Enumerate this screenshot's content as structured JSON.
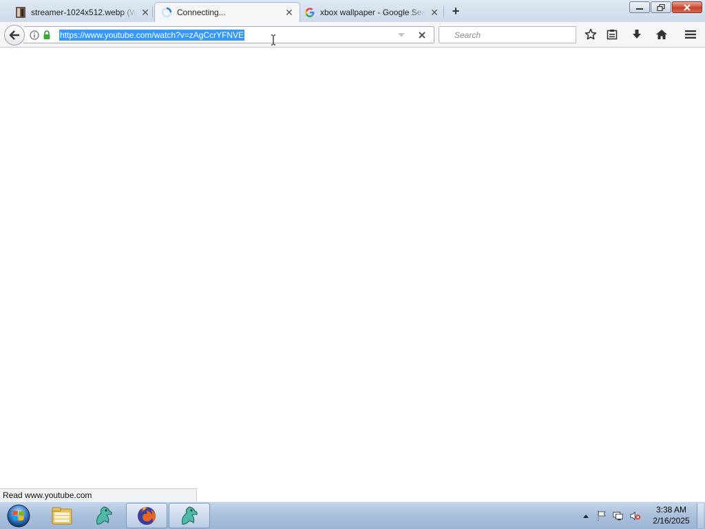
{
  "browser": {
    "tabs": [
      {
        "title": "streamer-1024x512.webp (W",
        "favicon": "image-thumbnail-icon",
        "active": false
      },
      {
        "title": "Connecting...",
        "favicon": "loading-spinner-icon",
        "active": true
      },
      {
        "title": "xbox wallpaper - Google Sea",
        "favicon": "google-g-icon",
        "active": false
      }
    ],
    "new_tab_label": "+",
    "url": "https://www.youtube.com/watch?v=zAgCcrYFNVE",
    "search_placeholder": "Search",
    "status_text": "Read www.youtube.com"
  },
  "toolbar_icons": [
    "back-arrow-icon",
    "info-icon",
    "lock-icon",
    "dropdown-arrow-icon",
    "stop-icon",
    "bookmark-star-icon",
    "reading-list-icon",
    "download-icon",
    "home-icon",
    "hamburger-menu-icon"
  ],
  "taskbar": {
    "pinned": [
      "windows-explorer-icon",
      "app-dragon-icon",
      "firefox-icon",
      "app-dragon-icon"
    ],
    "clock_time": "3:38 AM",
    "clock_date": "2/16/2025"
  },
  "colors": {
    "url_selection": "#3399ff",
    "close_button": "#c8442c",
    "taskbar": "#a9c0dc"
  }
}
